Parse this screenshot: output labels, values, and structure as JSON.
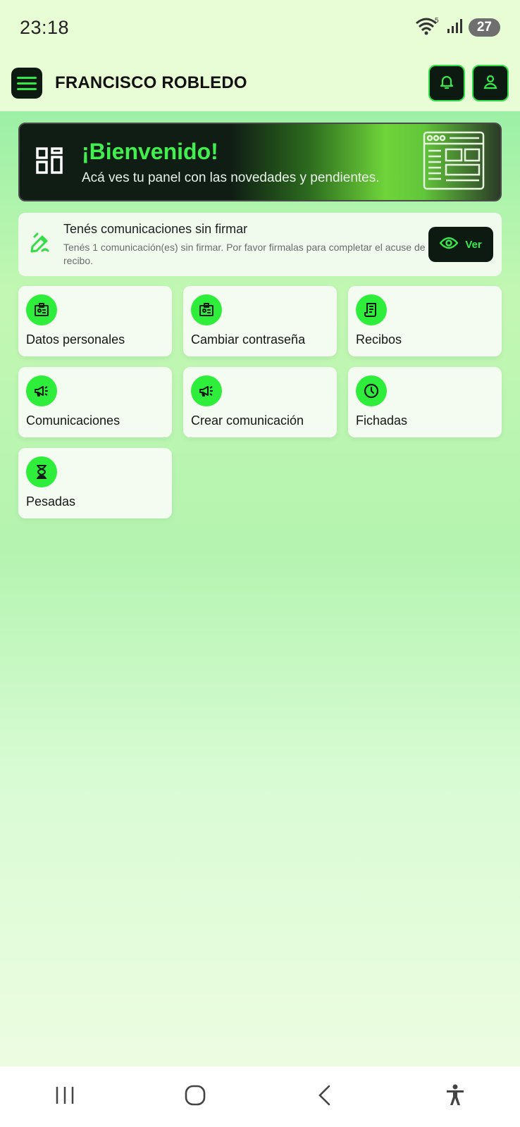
{
  "status_bar": {
    "time": "23:18",
    "battery": "27",
    "network": "5"
  },
  "header": {
    "user_name": "FRANCISCO ROBLEDO"
  },
  "banner": {
    "title": "¡Bienvenido!",
    "subtitle": "Acá ves tu panel con las novedades y pendientes."
  },
  "notice": {
    "title": "Tenés comunicaciones sin firmar",
    "description": "Tenés 1 comunicación(es) sin firmar. Por favor firmalas para completar el acuse de recibo.",
    "button_label": "Ver"
  },
  "tiles": [
    {
      "label": "Datos personales",
      "icon": "id-card-icon"
    },
    {
      "label": "Cambiar contraseña",
      "icon": "id-card-icon"
    },
    {
      "label": "Recibos",
      "icon": "receipt-icon"
    },
    {
      "label": "Comunicaciones",
      "icon": "megaphone-icon"
    },
    {
      "label": "Crear comunicación",
      "icon": "megaphone-icon"
    },
    {
      "label": "Fichadas",
      "icon": "clock-icon"
    },
    {
      "label": "Pesadas",
      "icon": "hourglass-icon"
    }
  ],
  "colors": {
    "accent": "#2fee3b",
    "dark": "#0d1a12",
    "banner_title": "#41f04f"
  }
}
